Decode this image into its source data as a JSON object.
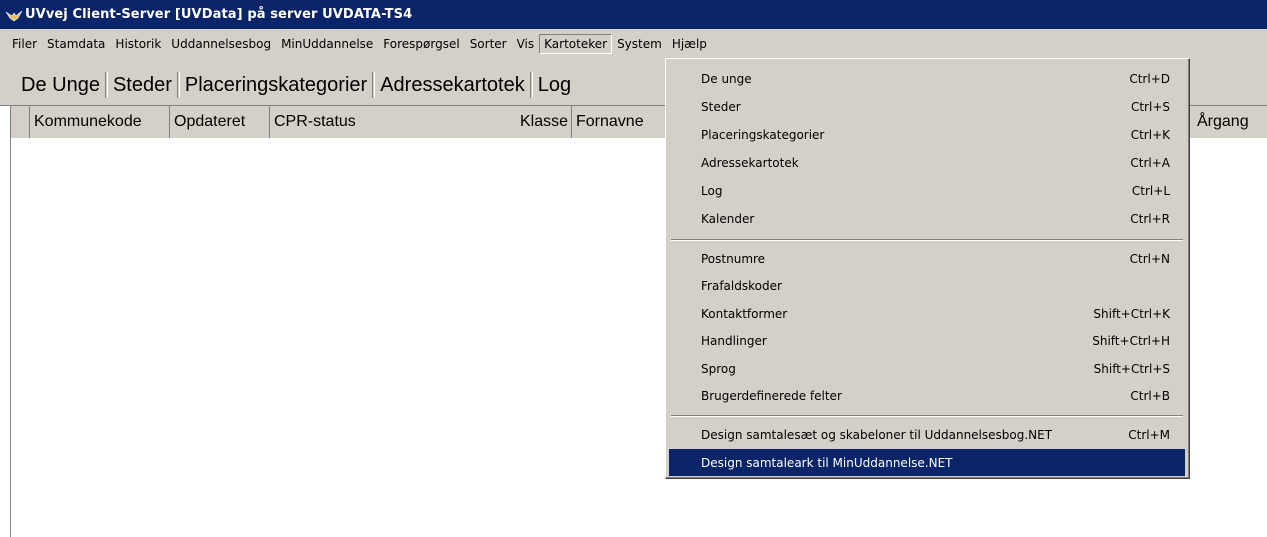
{
  "window": {
    "title": "UVvej Client-Server [UVData] på server UVDATA-TS4"
  },
  "menubar": [
    {
      "label": "Filer"
    },
    {
      "label": "Stamdata"
    },
    {
      "label": "Historik"
    },
    {
      "label": "Uddannelsesbog"
    },
    {
      "label": "MinUddannelse"
    },
    {
      "label": "Forespørgsel"
    },
    {
      "label": "Sorter"
    },
    {
      "label": "Vis"
    },
    {
      "label": "Kartoteker"
    },
    {
      "label": "System"
    },
    {
      "label": "Hjælp"
    }
  ],
  "tabs": [
    {
      "label": "De Unge"
    },
    {
      "label": "Steder"
    },
    {
      "label": "Placeringskategorier"
    },
    {
      "label": "Adressekartotek"
    },
    {
      "label": "Log"
    }
  ],
  "columns": [
    {
      "label": "Kommunekode"
    },
    {
      "label": "Opdateret"
    },
    {
      "label": "CPR-status"
    },
    {
      "label": "Klasse"
    },
    {
      "label": "Fornavne"
    },
    {
      "label": "Årgang"
    }
  ],
  "dropdown": {
    "items": [
      {
        "label": "De unge",
        "shortcut": "Ctrl+D"
      },
      {
        "label": "Steder",
        "shortcut": "Ctrl+S"
      },
      {
        "label": "Placeringskategorier",
        "shortcut": "Ctrl+K"
      },
      {
        "label": "Adressekartotek",
        "shortcut": "Ctrl+A"
      },
      {
        "label": "Log",
        "shortcut": "Ctrl+L"
      },
      {
        "label": "Kalender",
        "shortcut": "Ctrl+R"
      },
      {
        "label": "Postnumre",
        "shortcut": "Ctrl+N"
      },
      {
        "label": "Frafaldskoder",
        "shortcut": ""
      },
      {
        "label": "Kontaktformer",
        "shortcut": "Shift+Ctrl+K"
      },
      {
        "label": "Handlinger",
        "shortcut": "Shift+Ctrl+H"
      },
      {
        "label": "Sprog",
        "shortcut": "Shift+Ctrl+S"
      },
      {
        "label": "Brugerdefinerede felter",
        "shortcut": "Ctrl+B"
      },
      {
        "label": "Design samtalesæt og skabeloner til Uddannelsesbog.NET",
        "shortcut": "Ctrl+M"
      },
      {
        "label": "Design samtaleark til MinUddannelse.NET",
        "shortcut": ""
      }
    ]
  },
  "colors": {
    "titlebar": "#0a246a",
    "chrome": "#d4d0c8",
    "highlight": "#0a246a"
  },
  "icons": {
    "app": "bird-icon"
  }
}
